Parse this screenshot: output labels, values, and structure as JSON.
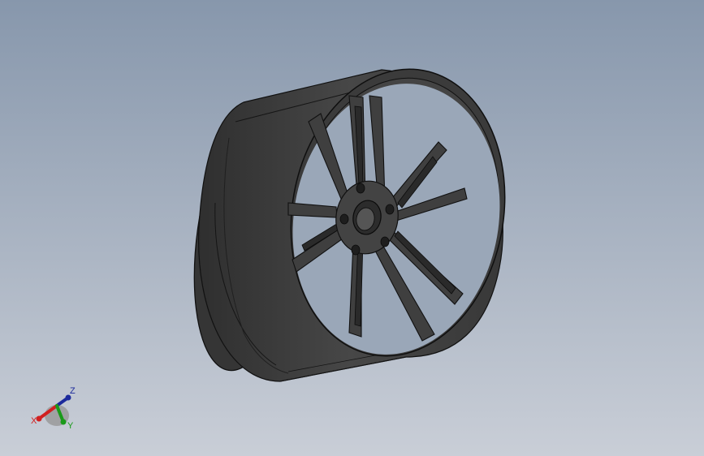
{
  "viewport": {
    "background_top": "#8797ac",
    "background_bottom": "#c9ced7"
  },
  "model": {
    "part": "wheel-rim",
    "spoke_count": 10,
    "lug_hole_count": 5,
    "shading_color": "#3d3d3d",
    "edge_color": "#121212"
  },
  "triad": {
    "x_label": "X",
    "y_label": "Y",
    "z_label": "Z",
    "x_color": "#d12020",
    "y_color": "#1a9a1a",
    "z_color": "#1c2a9c"
  }
}
